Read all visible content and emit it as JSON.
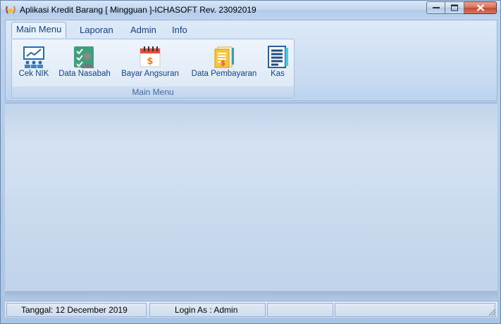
{
  "window": {
    "title": "Aplikasi Kredit Barang [ Mingguan ]-ICHASOFT Rev. 23092019"
  },
  "ribbon": {
    "tabs": [
      {
        "label": "Main Menu",
        "active": true
      },
      {
        "label": "Laporan",
        "active": false
      },
      {
        "label": "Admin",
        "active": false
      },
      {
        "label": "Info",
        "active": false
      }
    ],
    "group": {
      "label": "Main Menu",
      "buttons": [
        {
          "label": "Cek NIK",
          "icon": "chart-board-icon"
        },
        {
          "label": "Data Nasabah",
          "icon": "customers-checklist-icon"
        },
        {
          "label": "Bayar Angsuran",
          "icon": "calendar-dollar-icon"
        },
        {
          "label": "Data Pembayaran",
          "icon": "payment-document-icon"
        },
        {
          "label": "Kas",
          "icon": "cash-ledger-icon"
        }
      ]
    }
  },
  "statusbar": {
    "tanggal": "Tanggal:  12 December 2019",
    "login": "Login As : Admin",
    "panel3": "",
    "panel4": ""
  },
  "colors": {
    "accent_text": "#15428b",
    "ribbon_bg": "#c9dbf1",
    "close_button": "#c44a31"
  }
}
